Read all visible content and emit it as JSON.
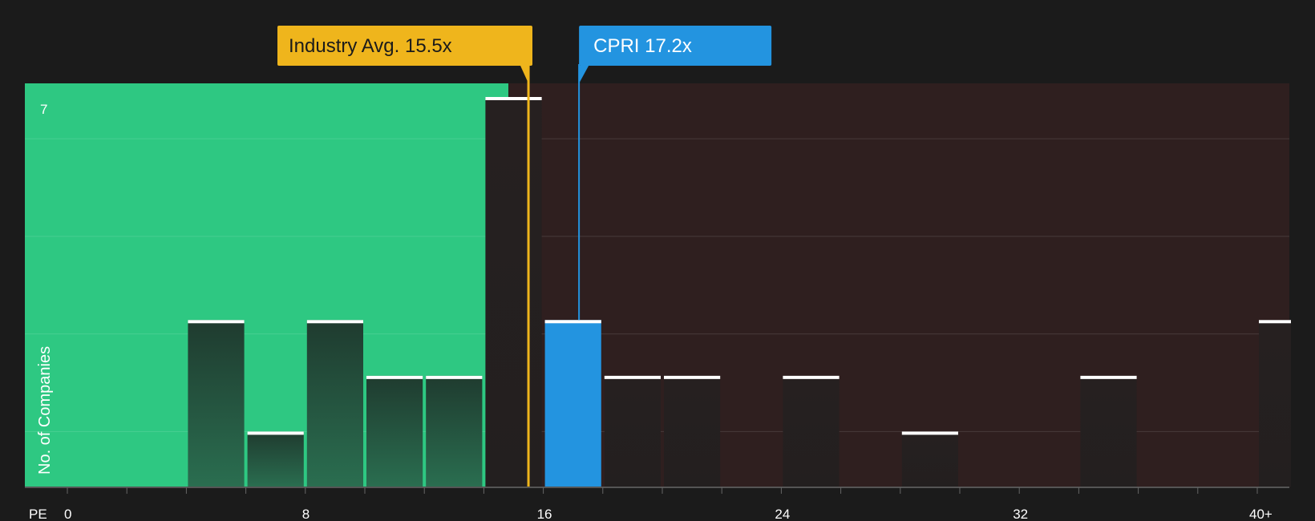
{
  "chart_data": {
    "type": "bar",
    "xlabel": "PE",
    "ylabel": "No. of Companies",
    "x_ticks": [
      "0",
      "8",
      "16",
      "24",
      "32",
      "40+"
    ],
    "y_ticks": [
      "7"
    ],
    "xlim": [
      0,
      40
    ],
    "ylim": [
      0,
      7
    ],
    "bin_width": 2,
    "bins": [
      {
        "start": 0,
        "count": 0
      },
      {
        "start": 2,
        "count": 0
      },
      {
        "start": 4,
        "count": 3
      },
      {
        "start": 6,
        "count": 1
      },
      {
        "start": 8,
        "count": 3
      },
      {
        "start": 10,
        "count": 2
      },
      {
        "start": 12,
        "count": 2
      },
      {
        "start": 14,
        "count": 7
      },
      {
        "start": 16,
        "count": 3,
        "highlight": true
      },
      {
        "start": 18,
        "count": 2
      },
      {
        "start": 20,
        "count": 2
      },
      {
        "start": 22,
        "count": 0
      },
      {
        "start": 24,
        "count": 2
      },
      {
        "start": 26,
        "count": 0
      },
      {
        "start": 28,
        "count": 1
      },
      {
        "start": 30,
        "count": 0
      },
      {
        "start": 32,
        "count": 0
      },
      {
        "start": 34,
        "count": 2
      },
      {
        "start": 36,
        "count": 0
      },
      {
        "start": 38,
        "count": 0
      },
      {
        "start": 40,
        "count": 3
      }
    ],
    "industry_avg": {
      "label": "Industry Avg. 15.5x",
      "value": 15.5
    },
    "company": {
      "label": "CPRI 17.2x",
      "value": 17.2
    },
    "grid": true,
    "colors": {
      "background": "#1b1b1b",
      "good_region": "#2ec882",
      "bad_region": "#2f1f1f",
      "bar": "#24352d",
      "highlight_bar": "#2394e0",
      "industry": "#efb51c",
      "company": "#2394e0",
      "bar_top": "#ffffff"
    }
  }
}
